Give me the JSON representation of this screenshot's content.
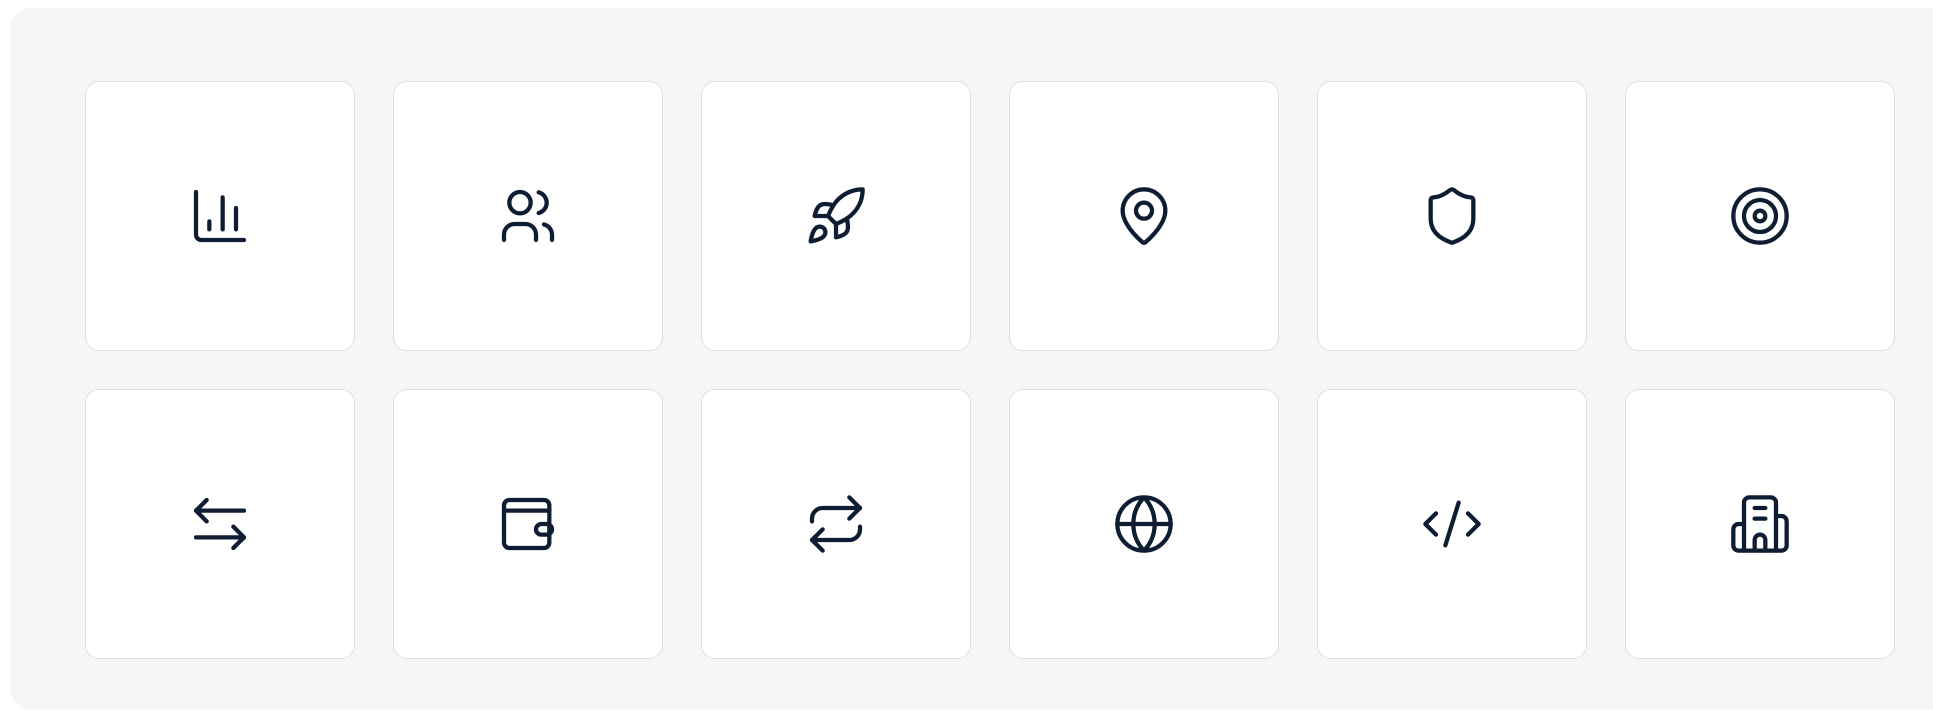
{
  "colors": {
    "panel_background": "#f5f6f8",
    "tile_background": "#ffffff",
    "tile_border": "#dcdfe4",
    "icon_stroke": "#0f1d33"
  },
  "icons": [
    "bar-chart-icon",
    "users-icon",
    "rocket-icon",
    "map-pin-icon",
    "shield-icon",
    "target-icon",
    "arrows-left-right-icon",
    "wallet-icon",
    "repeat-icon",
    "globe-icon",
    "code-icon",
    "building-icon"
  ]
}
